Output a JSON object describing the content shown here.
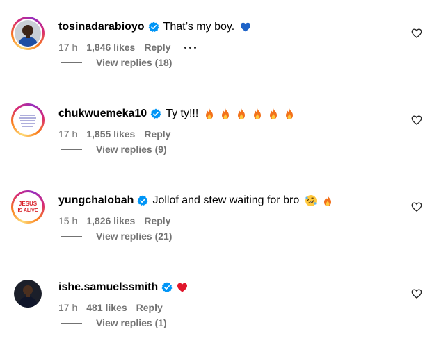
{
  "comments": [
    {
      "username": "tosinadarabioyo",
      "text": "That’s my boy.",
      "emojis": [
        "blue-heart"
      ],
      "time": "17 h",
      "likes": "1,846 likes",
      "reply_label": "Reply",
      "has_more": true,
      "view_replies": "View replies (18)",
      "avatar": "photo-person",
      "ring": true
    },
    {
      "username": "chukwuemeka10",
      "text": "Ty ty!!!",
      "emojis": [
        "fire",
        "fire",
        "fire",
        "fire",
        "fire",
        "fire"
      ],
      "time": "17 h",
      "likes": "1,855 likes",
      "reply_label": "Reply",
      "has_more": false,
      "view_replies": "View replies (9)",
      "avatar": "handwritten-note",
      "ring": true
    },
    {
      "username": "yungchalobah",
      "text": "Jollof and stew waiting for bro",
      "emojis": [
        "rolling-laughing",
        "fire"
      ],
      "time": "15 h",
      "likes": "1,826 likes",
      "reply_label": "Reply",
      "has_more": false,
      "view_replies": "View replies (21)",
      "avatar": "jesus-is-alive",
      "avatar_text": [
        "JESUS",
        "IS ALIVE"
      ],
      "ring": true
    },
    {
      "username": "ishe.samuelssmith",
      "text": "",
      "emojis": [
        "red-heart"
      ],
      "time": "17 h",
      "likes": "481 likes",
      "reply_label": "Reply",
      "has_more": false,
      "view_replies": "View replies (1)",
      "avatar": "photo-person-dark",
      "ring": false
    }
  ],
  "colors": {
    "secondary_text": "#737373",
    "verified_blue": "#0095f6",
    "like_outline": "#262626"
  }
}
